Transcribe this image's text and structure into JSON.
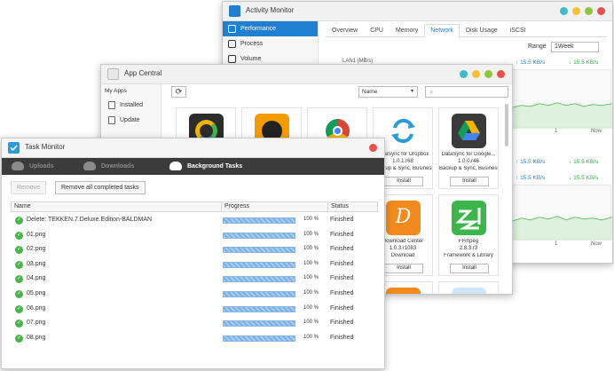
{
  "colors": {
    "accent": "#1f7fd0",
    "tm_accent": "#2b9ad8",
    "dot_teal": "#3dbbc6",
    "dot_yellow": "#f5c12e",
    "dot_green": "#8dc63f",
    "dot_red": "#e9504b",
    "check_green": "#47b548",
    "dark_bar": "#3b3b3b"
  },
  "activity_monitor": {
    "title": "Activity Monitor",
    "side_items": [
      {
        "label": "Performance",
        "icon": "performance-icon"
      },
      {
        "label": "Process",
        "icon": "process-icon"
      },
      {
        "label": "Volume",
        "icon": "volume-icon"
      }
    ],
    "tabs": [
      "Overview",
      "CPU",
      "Memory",
      "Network",
      "Disk Usage",
      "iSCSI"
    ],
    "active_tab": "Network",
    "range_label": "Range",
    "range_value": "1Week",
    "lan_label": "LAN1 (MB/s)",
    "rates": [
      "15.5 KB/s",
      "15.5 KB/s",
      "15.5 KB/s",
      "15.5 KB/s",
      "15.5 KB/s",
      "15.5 KB/s"
    ],
    "ticks": [
      "1",
      "Now",
      "1",
      "Now"
    ]
  },
  "app_central": {
    "title": "App Central",
    "my_apps": "My Apps",
    "side_items": [
      "Installed",
      "Update"
    ],
    "sort_value": "Name",
    "apps": [
      {
        "name": "",
        "version": "",
        "category": "",
        "install": ""
      },
      {
        "name": "",
        "version": "",
        "category": "",
        "install": ""
      },
      {
        "name": "",
        "version": "",
        "category": "",
        "install": ""
      },
      {
        "name": "DataSync for Dropbox",
        "version": "1.0.1.r68",
        "category": "Backup & Sync, Business A...",
        "install": "Install"
      },
      {
        "name": "DataSync for Google...",
        "version": "1.0.0.r46",
        "category": "Backup & Sync, Business A...",
        "install": "Install"
      },
      {
        "name": "Download Center",
        "version": "1.0.3.r1083",
        "category": "Download",
        "install": "Install"
      },
      {
        "name": "FFmpeg",
        "version": "2.8.3.r3",
        "category": "Framework & Library",
        "install": "Install"
      }
    ]
  },
  "task_monitor": {
    "title": "Task Monitor",
    "tabs": [
      {
        "label": "Uploads",
        "icon": "upload-cloud-icon"
      },
      {
        "label": "Downloads",
        "icon": "download-cloud-icon"
      },
      {
        "label": "Background Tasks",
        "icon": "background-tasks-icon"
      }
    ],
    "active_tab": "Background Tasks",
    "remove_label": "Remove",
    "remove_all_label": "Remove all completed tasks",
    "columns": [
      "Name",
      "Progress",
      "Status"
    ],
    "rows": [
      {
        "name": "Delete: TEKKEN.7.Deluxe.Edition-BALDMAN",
        "progress": 1.0,
        "progress_text": "100 %",
        "status": "Finished"
      },
      {
        "name": "01.png",
        "progress": 1.0,
        "progress_text": "100 %",
        "status": "Finished"
      },
      {
        "name": "02.png",
        "progress": 1.0,
        "progress_text": "100 %",
        "status": "Finished"
      },
      {
        "name": "03.png",
        "progress": 1.0,
        "progress_text": "100 %",
        "status": "Finished"
      },
      {
        "name": "04.png",
        "progress": 1.0,
        "progress_text": "100 %",
        "status": "Finished"
      },
      {
        "name": "05.png",
        "progress": 1.0,
        "progress_text": "100 %",
        "status": "Finished"
      },
      {
        "name": "06.png",
        "progress": 1.0,
        "progress_text": "100 %",
        "status": "Finished"
      },
      {
        "name": "07.png",
        "progress": 1.0,
        "progress_text": "100 %",
        "status": "Finished"
      },
      {
        "name": "08.png",
        "progress": 1.0,
        "progress_text": "100 %",
        "status": "Finished"
      }
    ]
  }
}
